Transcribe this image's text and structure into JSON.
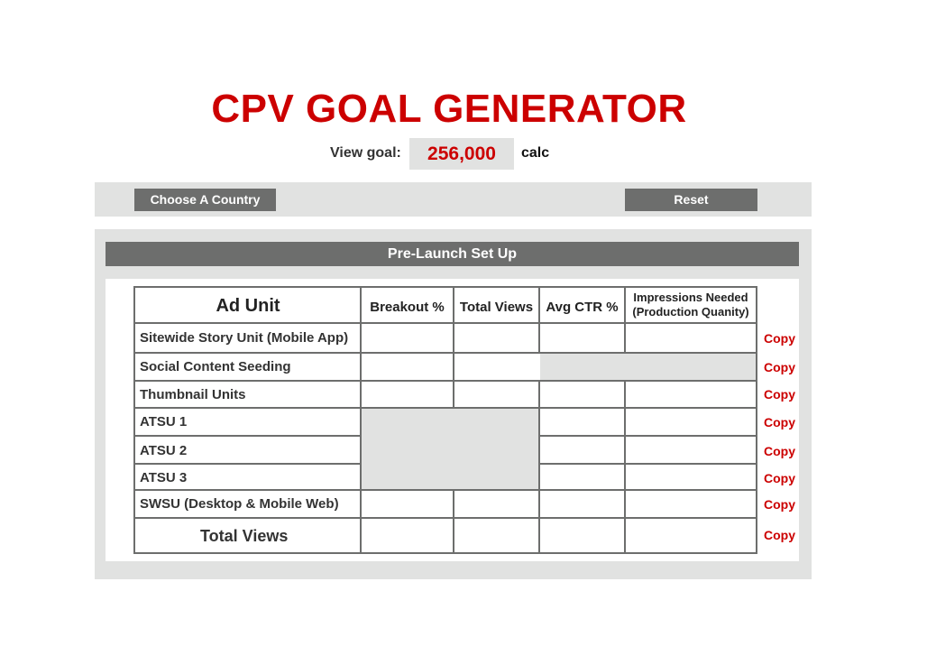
{
  "title": "CPV GOAL GENERATOR",
  "view_goal": {
    "label": "View goal:",
    "value": "256,000",
    "calc_label": "calc"
  },
  "toolbar": {
    "country_label": "Choose A Country",
    "reset_label": "Reset"
  },
  "panel": {
    "header": "Pre-Launch Set Up"
  },
  "table": {
    "headers": {
      "ad_unit": "Ad Unit",
      "breakout": "Breakout %",
      "total_views": "Total Views",
      "avg_ctr": "Avg CTR %",
      "impressions": "Impressions Needed (Production Quanity)"
    },
    "rows": [
      {
        "label": "Sitewide Story Unit (Mobile App)",
        "copy": "Copy"
      },
      {
        "label": "Social Content Seeding",
        "copy": "Copy"
      },
      {
        "label": "Thumbnail Units",
        "copy": "Copy"
      },
      {
        "label": "ATSU 1",
        "copy": "Copy"
      },
      {
        "label": "ATSU 2",
        "copy": "Copy"
      },
      {
        "label": "ATSU 3",
        "copy": "Copy"
      },
      {
        "label": "SWSU (Desktop & Mobile Web)",
        "copy": "Copy"
      }
    ],
    "total": {
      "label": "Total Views",
      "copy": "Copy"
    }
  },
  "colors": {
    "accent": "#cc0000",
    "button_bg": "#6d6e6d",
    "panel_bg": "#e1e2e1"
  }
}
